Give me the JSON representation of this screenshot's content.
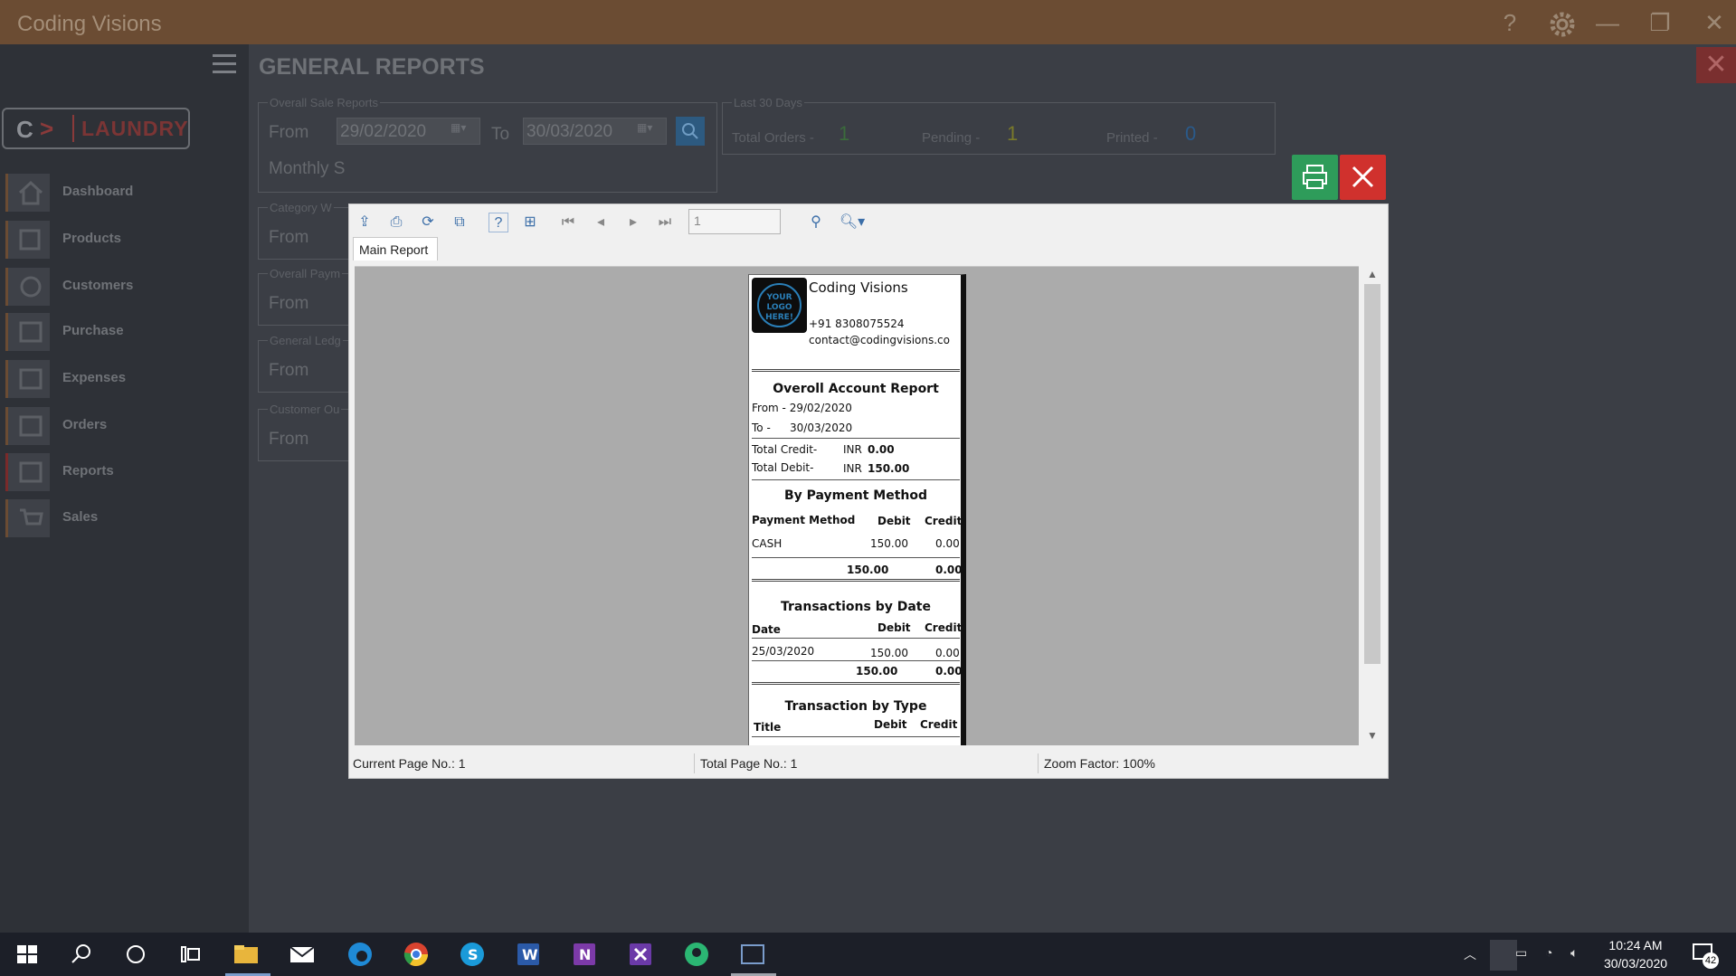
{
  "app": {
    "title": "Coding Visions",
    "page_title": "GENERAL REPORTS",
    "logo": {
      "letter": "C",
      "name": "LAUNDRY"
    }
  },
  "sidebar": {
    "items": [
      {
        "label": "Dashboard",
        "icon": "home-icon"
      },
      {
        "label": "Products",
        "icon": "products-icon"
      },
      {
        "label": "Customers",
        "icon": "customers-icon"
      },
      {
        "label": "Purchase",
        "icon": "purchase-icon"
      },
      {
        "label": "Expenses",
        "icon": "expenses-icon"
      },
      {
        "label": "Orders",
        "icon": "orders-icon"
      },
      {
        "label": "Reports",
        "icon": "reports-icon"
      },
      {
        "label": "Sales",
        "icon": "sales-icon"
      }
    ]
  },
  "filters": {
    "overall_sale": {
      "legend": "Overall Sale Reports",
      "from_label": "From",
      "from": "29/02/2020",
      "to_label": "To",
      "to": "30/03/2020",
      "monthly": "Monthly S"
    },
    "category": {
      "legend": "Category W",
      "from_label": "From"
    },
    "overall_payment": {
      "legend": "Overall Paym",
      "from_label": "From"
    },
    "general_ledger": {
      "legend": "General Ledg",
      "from_label": "From"
    },
    "customer": {
      "legend": "Customer Ou",
      "from_label": "From"
    }
  },
  "stats": {
    "legend": "Last 30 Days",
    "total_orders_label": "Total Orders -",
    "total_orders": "1",
    "pending_label": "Pending -",
    "pending": "1",
    "printed_label": "Printed -",
    "printed": "0",
    "colors": {
      "orders": "#3b6b3b",
      "pending": "#7a7a2a",
      "printed": "#2a5a8a"
    }
  },
  "viewer": {
    "page_input": "1",
    "tab": "Main Report",
    "status": {
      "current_page": "Current Page No.: 1",
      "total_page": "Total Page No.: 1",
      "zoom": "Zoom Factor: 100%"
    }
  },
  "receipt": {
    "logo_text": "YOUR LOGO HERE!",
    "company": "Coding Visions",
    "phone": "+91 8308075524",
    "email": "contact@codingvisions.co",
    "title": "Overoll Account Report",
    "from": "From - 29/02/2020",
    "to_label": "To -",
    "to": "30/03/2020",
    "credit_label": "Total Credit-",
    "debit_label": "Total Debit-",
    "currency": "INR",
    "credit": "0.00",
    "debit": "150.00",
    "by_method": {
      "title": "By Payment Method",
      "headers": [
        "Payment Method",
        "Debit",
        "Credit"
      ],
      "row": [
        "CASH",
        "150.00",
        "0.00"
      ],
      "totals": [
        "150.00",
        "0.00"
      ]
    },
    "by_date": {
      "title": "Transactions by Date",
      "headers": [
        "Date",
        "Debit",
        "Credit"
      ],
      "row": [
        "25/03/2020",
        "150.00",
        "0.00"
      ],
      "totals": [
        "150.00",
        "0.00"
      ]
    },
    "by_type": {
      "title": "Transaction by Type",
      "headers": [
        "Title",
        "Debit",
        "Credit"
      ]
    }
  },
  "taskbar": {
    "time": "10:24 AM",
    "date": "30/03/2020",
    "notifications": "42"
  }
}
